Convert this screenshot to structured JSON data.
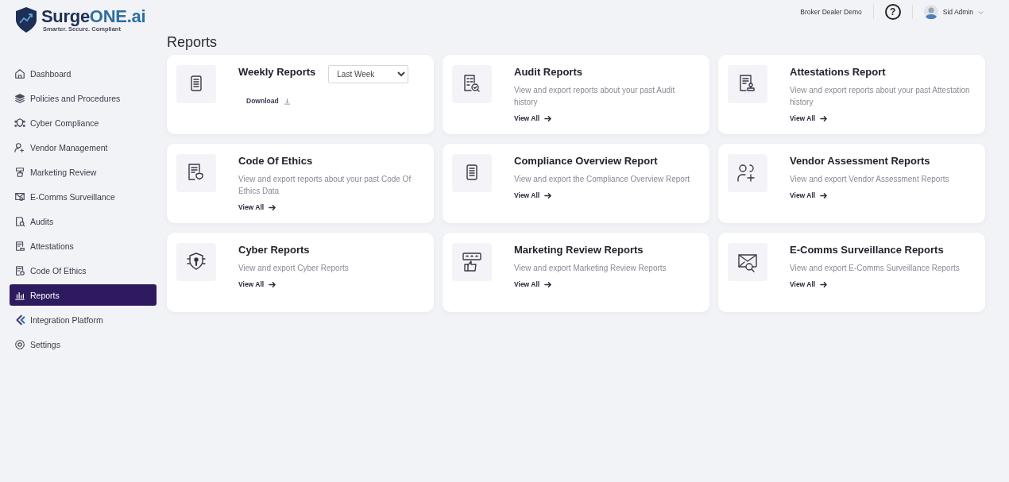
{
  "brand": {
    "name": "Surge",
    "name_accent": "ONE.ai",
    "tagline": "Smarter. Secure. Compliant"
  },
  "header": {
    "org": "Broker Dealer Demo",
    "help": "?",
    "user": "Sid Admin"
  },
  "nav": {
    "items": [
      {
        "label": "Dashboard",
        "selected": false
      },
      {
        "label": "Policies and Procedures",
        "selected": false
      },
      {
        "label": "Cyber Compliance",
        "selected": false
      },
      {
        "label": "Vendor Management",
        "selected": false
      },
      {
        "label": "Marketing Review",
        "selected": false
      },
      {
        "label": "E-Comms Surveillance",
        "selected": false
      },
      {
        "label": "Audits",
        "selected": false
      },
      {
        "label": "Attestations",
        "selected": false
      },
      {
        "label": "Code Of Ethics",
        "selected": false
      },
      {
        "label": "Reports",
        "selected": true
      },
      {
        "label": "Integration Platform",
        "selected": false
      },
      {
        "label": "Settings",
        "selected": false
      }
    ]
  },
  "page_title": "Reports",
  "cards": [
    {
      "kind": "weekly",
      "title": "Weekly Reports",
      "period": "Last Week",
      "action": "Download"
    },
    {
      "kind": "standard",
      "title": "Audit Reports",
      "description": "View and export reports about your past Audit history",
      "action": "View All"
    },
    {
      "kind": "standard",
      "title": "Attestations Report",
      "description": "View and export reports about your past Attestation history",
      "action": "View All"
    },
    {
      "kind": "standard",
      "title": "Code Of Ethics",
      "description": "View and export reports about your past Code Of Ethics Data",
      "action": "View All"
    },
    {
      "kind": "standard",
      "title": "Compliance Overview Report",
      "description": "View and export the Compliance Overview Report",
      "action": "View All"
    },
    {
      "kind": "standard",
      "title": "Vendor Assessment Reports",
      "description": "View and export Vendor Assessment Reports",
      "action": "View All"
    },
    {
      "kind": "standard",
      "title": "Cyber Reports",
      "description": "View and export Cyber Reports",
      "action": "View All"
    },
    {
      "kind": "standard",
      "title": "Marketing Review Reports",
      "description": "View and export Marketing Review Reports",
      "action": "View All"
    },
    {
      "kind": "standard",
      "title": "E-Comms Surveillance Reports",
      "description": "View and export E-Comms Surveillance Reports",
      "action": "View All"
    }
  ]
}
